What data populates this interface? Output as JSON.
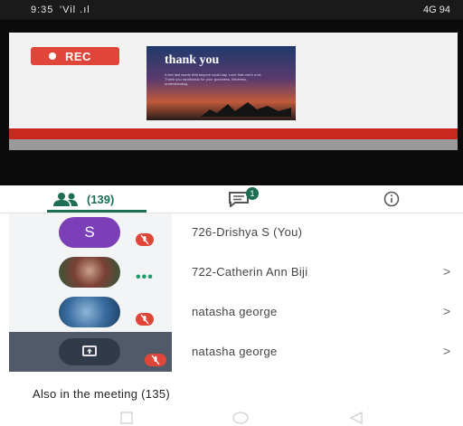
{
  "status_bar": {
    "time": "9:35",
    "network": "'Vil .ıl",
    "right": "4G 94"
  },
  "video": {
    "rec_label": "REC",
    "slide_title": "thank you",
    "slide_body": "A few last words that anyone could say. Love that one's a lot. Thank you rapidiously for your goodness, kindness, understanding."
  },
  "tabs": {
    "people_count": "(139)",
    "chat_badge": "1"
  },
  "participants": [
    {
      "name": "726-Drishya S (You)",
      "avatar_text": "S",
      "muted": true,
      "chevron": ""
    },
    {
      "name": "722-Catherin Ann Biji",
      "avatar_text": "",
      "muted": false,
      "chevron": ">"
    },
    {
      "name": "natasha george",
      "avatar_text": "",
      "muted": true,
      "chevron": ">"
    },
    {
      "name": "natasha george",
      "avatar_text": "",
      "muted": true,
      "chevron": ">"
    }
  ],
  "also_in_meeting": "Also in the meeting (135)",
  "colors": {
    "accent": "#1e6e54",
    "rec": "#e0453a",
    "avatar_purple": "#7b3fb8"
  },
  "icons": [
    "people-icon",
    "chat-icon",
    "info-icon",
    "mic-off-icon",
    "more-dots-icon",
    "present-screen-icon",
    "nav-square-icon",
    "nav-circle-icon",
    "nav-back-icon"
  ]
}
